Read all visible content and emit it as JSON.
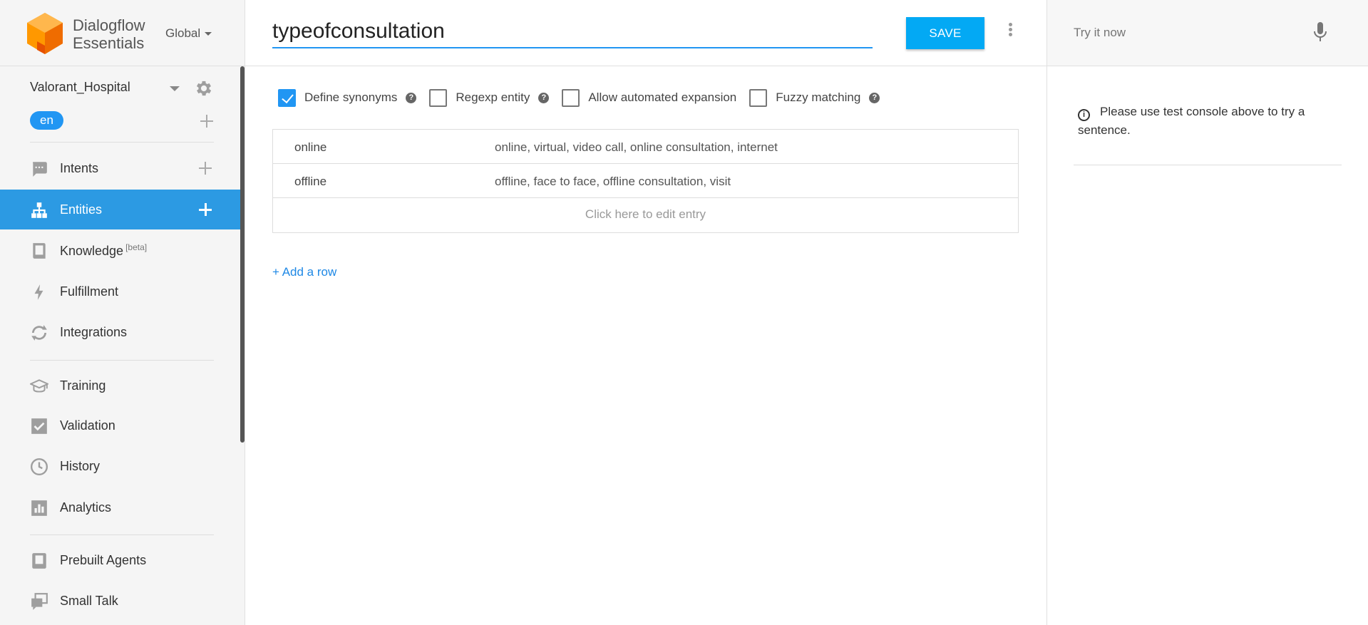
{
  "brand": {
    "name_line1": "Dialogflow",
    "name_line2": "Essentials",
    "region": "Global"
  },
  "agent": {
    "name": "Valorant_Hospital",
    "language": "en"
  },
  "sidebar": {
    "items": [
      {
        "label": "Intents",
        "icon": "intents-icon"
      },
      {
        "label": "Entities",
        "icon": "entities-icon",
        "active": true
      },
      {
        "label": "Knowledge",
        "beta": "[beta]",
        "icon": "knowledge-icon"
      },
      {
        "label": "Fulfillment",
        "icon": "fulfillment-icon"
      },
      {
        "label": "Integrations",
        "icon": "integrations-icon"
      },
      {
        "label": "Training",
        "icon": "training-icon"
      },
      {
        "label": "Validation",
        "icon": "validation-icon"
      },
      {
        "label": "History",
        "icon": "history-icon"
      },
      {
        "label": "Analytics",
        "icon": "analytics-icon"
      },
      {
        "label": "Prebuilt Agents",
        "icon": "prebuilt-agents-icon"
      },
      {
        "label": "Small Talk",
        "icon": "small-talk-icon"
      }
    ]
  },
  "editor": {
    "entity_name": "typeofconsultation",
    "save_label": "SAVE",
    "options": [
      {
        "label": "Define synonyms",
        "checked": true,
        "help": true
      },
      {
        "label": "Regexp entity",
        "checked": false,
        "help": true
      },
      {
        "label": "Allow automated expansion",
        "checked": false,
        "help": false
      },
      {
        "label": "Fuzzy matching",
        "checked": false,
        "help": true
      }
    ],
    "entries": [
      {
        "value": "online",
        "synonyms": "online, virtual, video call, online consultation, internet"
      },
      {
        "value": "offline",
        "synonyms": "offline, face to face, offline consultation, visit"
      }
    ],
    "edit_hint": "Click here to edit entry",
    "add_row": "+ Add a row"
  },
  "test_console": {
    "placeholder": "Try it now",
    "info_message": "Please use test console above to try a sentence."
  },
  "colors": {
    "accent": "#2c9ae3",
    "save_button": "#03a9f4",
    "link": "#1e88e5",
    "logo": "#ff9800"
  }
}
